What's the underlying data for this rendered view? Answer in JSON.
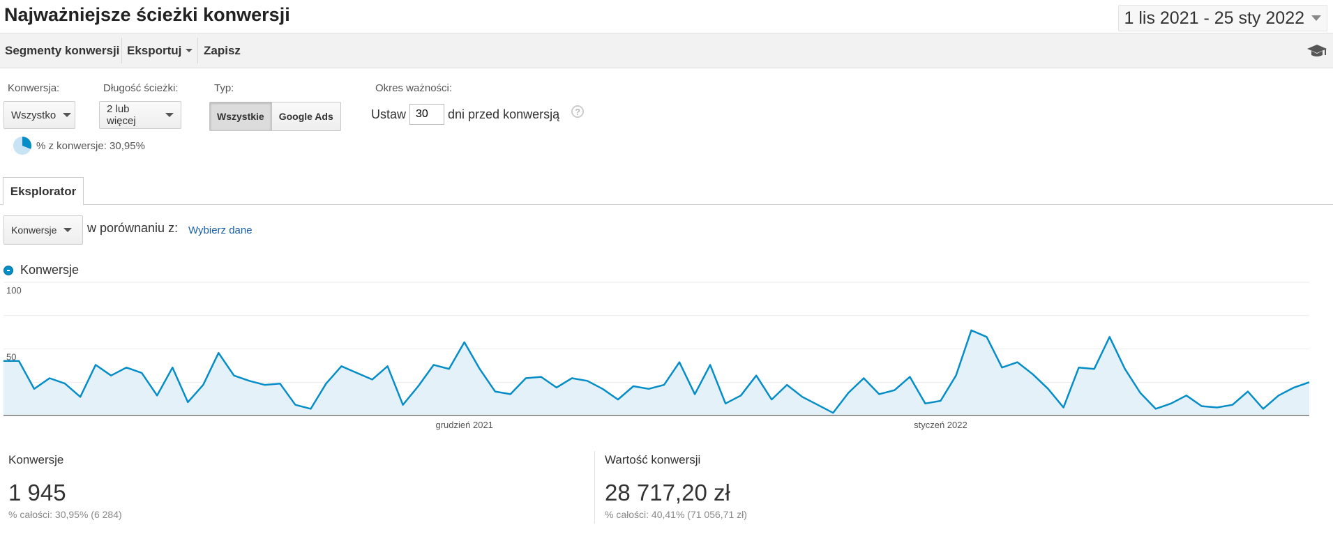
{
  "page": {
    "title": "Najważniejsze ścieżki konwersji",
    "date_range": "1 lis 2021 - 25 sty 2022"
  },
  "toolbar": {
    "segments": "Segmenty konwersji",
    "export": "Eksportuj",
    "save": "Zapisz",
    "icon": "graduation-cap-icon"
  },
  "filters": {
    "conversion_label": "Konwersja:",
    "conversion_value": "Wszystko",
    "path_length_label": "Długość ścieżki:",
    "path_length_value": "2 lub więcej",
    "type_label": "Typ:",
    "type_all": "Wszystkie",
    "type_ads": "Google Ads",
    "validity_label": "Okres ważności:",
    "set_label": "Ustaw",
    "days_value": "30",
    "days_suffix": "dni przed konwersją",
    "help": "?",
    "percent_text": "% z konwersje: 30,95%",
    "percent_value": 0.3095
  },
  "tabs": [
    {
      "label": "Eksplorator",
      "active": true
    }
  ],
  "compare": {
    "metric": "Konwersje",
    "compare_label": "w porównaniu z:",
    "choose_link": "Wybierz dane"
  },
  "legend": {
    "series_name": "Konwersje"
  },
  "chart_data": {
    "type": "area",
    "series": [
      {
        "name": "Konwersje",
        "color": "#058dc7",
        "values": [
          41,
          41,
          20,
          28,
          24,
          14,
          38,
          30,
          36,
          32,
          15,
          36,
          10,
          23,
          47,
          30,
          26,
          23,
          24,
          8,
          5,
          24,
          37,
          32,
          27,
          37,
          8,
          22,
          38,
          35,
          55,
          35,
          18,
          16,
          28,
          29,
          21,
          28,
          26,
          20,
          12,
          22,
          20,
          23,
          40,
          16,
          38,
          9,
          15,
          30,
          12,
          23,
          14,
          8,
          2,
          17,
          28,
          16,
          19,
          29,
          9,
          11,
          30,
          64,
          59,
          36,
          40,
          31,
          20,
          6,
          36,
          35,
          59,
          35,
          17,
          5,
          9,
          15,
          7,
          6,
          8,
          18,
          5,
          15,
          21,
          25
        ],
        "x_start": "2021-11-01",
        "x_end": "2022-01-25"
      }
    ],
    "xtick_labels": [
      "grudzień 2021",
      "styczeń 2022"
    ],
    "ytick_labels": [
      "100",
      "50"
    ],
    "ylim": [
      0,
      100
    ],
    "grid": true
  },
  "metrics": [
    {
      "label": "Konwersje",
      "value": "1 945",
      "sub": "% całości: 30,95% (6 284)"
    },
    {
      "label": "Wartość konwersji",
      "value": "28 717,20 zł",
      "sub": "% całości: 40,41% (71 056,71 zł)"
    }
  ]
}
